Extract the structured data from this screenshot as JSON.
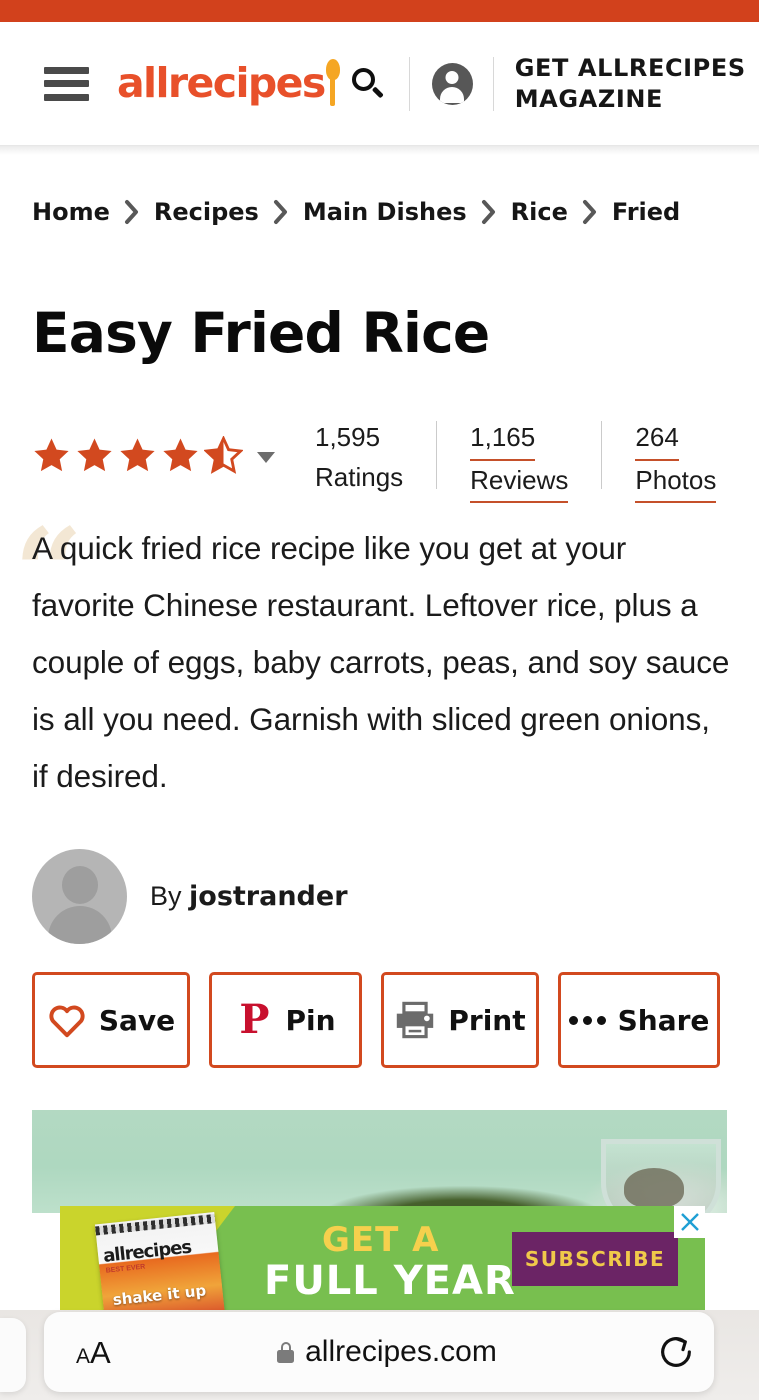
{
  "browser": {
    "url": "allrecipes.com",
    "lock_icon": "lock-icon",
    "text_size_small": "A",
    "text_size_large": "A",
    "reload_icon": "reload-icon",
    "tab_peek": "previous-tab"
  },
  "header": {
    "menu_icon": "hamburger-menu-icon",
    "logo_text": "allrecipes",
    "logo_spoon_icon": "spoon-icon",
    "search_icon": "search-icon",
    "account_icon": "account-avatar-icon",
    "magazine_label": "GET ALLRECIPES MAGAZINE",
    "accent_color": "#d2411c"
  },
  "breadcrumb": {
    "separator_icon": "chevron-right-icon",
    "items": [
      {
        "label": "Home"
      },
      {
        "label": "Recipes"
      },
      {
        "label": "Main Dishes"
      },
      {
        "label": "Rice"
      },
      {
        "label": "Fried"
      }
    ]
  },
  "recipe": {
    "title": "Easy Fried Rice",
    "rating": {
      "stars_filled": 4,
      "has_half_star": true,
      "star_color": "#d2491f",
      "dropdown_icon": "chevron-down-icon"
    },
    "stats": [
      {
        "num": "1,595",
        "label": "Ratings",
        "is_link": false
      },
      {
        "num": "1,165",
        "label": "Reviews",
        "is_link": true
      },
      {
        "num": "264",
        "label": "Photos",
        "is_link": true
      }
    ],
    "description": "A quick fried rice recipe like you get at your favorite Chinese restaurant. Leftover rice, plus a couple of eggs, baby carrots, peas, and soy sauce is all you need. Garnish with sliced green onions, if desired.",
    "quote_glyph": "“",
    "byline_prefix": "By ",
    "author": "jostrander",
    "avatar_icon": "author-avatar-placeholder"
  },
  "actions": [
    {
      "label": "Save",
      "icon": "heart-icon",
      "icon_color": "#d2491f"
    },
    {
      "label": "Pin",
      "icon": "pinterest-icon",
      "icon_color": "#c8102e",
      "glyph": "P"
    },
    {
      "label": "Print",
      "icon": "printer-icon",
      "icon_color": "#6b6b6b"
    },
    {
      "label": "Share",
      "icon": "ellipsis-icon",
      "icon_color": "#111111"
    }
  ],
  "hero": {
    "image_alt": "fried-rice-photo"
  },
  "ad": {
    "line1": "GET A",
    "line2": "FULL YEAR",
    "cta_label": "SUBSCRIBE",
    "magazine_logo": "allrecipes",
    "magazine_sub": "BEST EVER",
    "magazine_word": "shake it up",
    "close_icon": "close-x-icon",
    "bg_color": "#78bf4f",
    "wedge_color": "#cad42c",
    "cta_bg": "#6b2465",
    "cta_text_color": "#f0c94a"
  }
}
